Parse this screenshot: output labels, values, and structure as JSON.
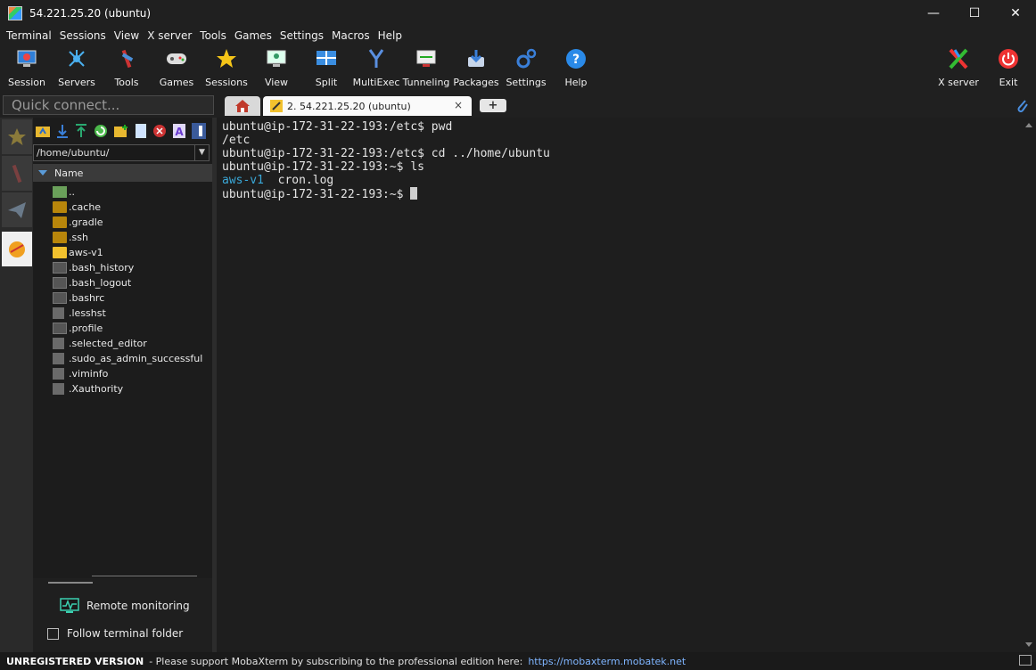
{
  "window": {
    "title": "54.221.25.20 (ubuntu)"
  },
  "menu": [
    "Terminal",
    "Sessions",
    "View",
    "X server",
    "Tools",
    "Games",
    "Settings",
    "Macros",
    "Help"
  ],
  "toolbar": {
    "session": "Session",
    "servers": "Servers",
    "tools": "Tools",
    "games": "Games",
    "sessions": "Sessions",
    "view": "View",
    "split": "Split",
    "multiexec": "MultiExec",
    "tunneling": "Tunneling",
    "packages": "Packages",
    "settings": "Settings",
    "help": "Help",
    "xserver": "X server",
    "exit": "Exit"
  },
  "quick_connect": {
    "placeholder": "Quick connect..."
  },
  "tabs": {
    "session_label": "2. 54.221.25.20 (ubuntu)",
    "close": "×",
    "add": "+"
  },
  "sftp": {
    "path": "/home/ubuntu/",
    "column": "Name",
    "files": [
      {
        "name": "..",
        "type": "up"
      },
      {
        "name": ".cache",
        "type": "folder"
      },
      {
        "name": ".gradle",
        "type": "folder"
      },
      {
        "name": ".ssh",
        "type": "folder"
      },
      {
        "name": "aws-v1",
        "type": "folder-open"
      },
      {
        "name": ".bash_history",
        "type": "dark"
      },
      {
        "name": ".bash_logout",
        "type": "dark"
      },
      {
        "name": ".bashrc",
        "type": "dark"
      },
      {
        "name": ".lesshst",
        "type": "doc"
      },
      {
        "name": ".profile",
        "type": "dark"
      },
      {
        "name": ".selected_editor",
        "type": "doc"
      },
      {
        "name": ".sudo_as_admin_successful",
        "type": "doc"
      },
      {
        "name": ".viminfo",
        "type": "doc"
      },
      {
        "name": ".Xauthority",
        "type": "doc"
      }
    ],
    "remote_monitoring": "Remote monitoring",
    "follow_folder": "Follow terminal folder"
  },
  "terminal": {
    "lines": [
      "ubuntu@ip-172-31-22-193:/etc$ pwd",
      "/etc",
      "ubuntu@ip-172-31-22-193:/etc$ cd ../home/ubuntu",
      "ubuntu@ip-172-31-22-193:~$ ls"
    ],
    "ls_dir": "aws-v1",
    "ls_file": "  cron.log",
    "prompt": "ubuntu@ip-172-31-22-193:~$ "
  },
  "status": {
    "label": "UNREGISTERED VERSION",
    "message": "-  Please support MobaXterm by subscribing to the professional edition here:",
    "link": "https://mobaxterm.mobatek.net"
  },
  "colors": {
    "accent": "#3aa8d8",
    "link": "#7fb5ff"
  }
}
